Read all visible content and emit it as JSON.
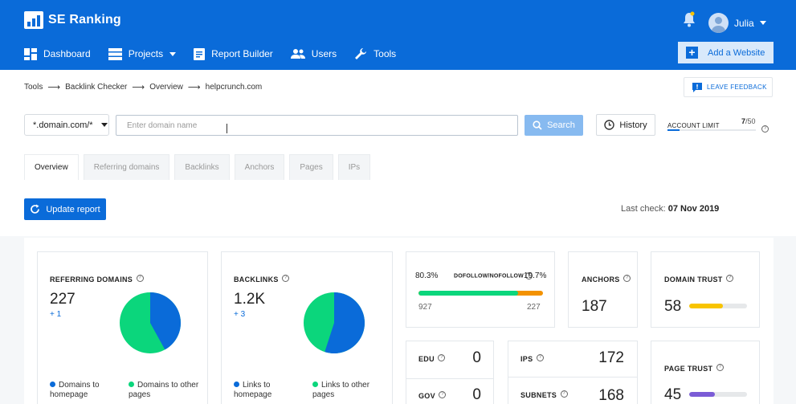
{
  "app": {
    "name": "SE Ranking"
  },
  "user": {
    "name": "Julia"
  },
  "nav": [
    {
      "id": "dashboard",
      "label": "Dashboard"
    },
    {
      "id": "projects",
      "label": "Projects"
    },
    {
      "id": "report-builder",
      "label": "Report Builder"
    },
    {
      "id": "users",
      "label": "Users"
    },
    {
      "id": "tools",
      "label": "Tools"
    }
  ],
  "add_website_label": "Add a Website",
  "breadcrumb": [
    "Tools",
    "Backlink Checker",
    "Overview",
    "helpcrunch.com"
  ],
  "leave_feedback_label": "LEAVE FEEDBACK",
  "search": {
    "mode": "*.domain.com/*",
    "placeholder": "Enter domain name",
    "button": "Search",
    "history": "History"
  },
  "account_limit": {
    "label": "ACCOUNT LIMIT",
    "used": "7",
    "total": "/50",
    "fraction": 0.14
  },
  "tabs": [
    "Overview",
    "Referring domains",
    "Backlinks",
    "Anchors",
    "Pages",
    "IPs"
  ],
  "update_report_label": "Update report",
  "last_check": {
    "label": "Last check:",
    "date": "07 Nov 2019"
  },
  "referring_domains": {
    "title": "REFERRING DOMAINS",
    "value": "227",
    "delta": "+ 1",
    "legend": [
      "Domains to homepage",
      "Domains to other pages"
    ],
    "homepage_fraction": 0.42
  },
  "backlinks": {
    "title": "BACKLINKS",
    "value": "1.2K",
    "delta": "+ 3",
    "legend": [
      "Links to homepage",
      "Links to other pages"
    ],
    "homepage_fraction": 0.55
  },
  "dofollow": {
    "title": "DOFOLLOW/NOFOLLOW",
    "dofollow_pct": "80.3%",
    "nofollow_pct": "19.7%",
    "dofollow_count": "927",
    "nofollow_count": "227",
    "fraction": 0.803
  },
  "anchors": {
    "title": "ANCHORS",
    "value": "187"
  },
  "domain_trust": {
    "title": "DOMAIN TRUST",
    "value": "58",
    "fraction": 0.58
  },
  "edu": {
    "title": "EDU",
    "value": "0"
  },
  "gov": {
    "title": "GOV",
    "value": "0"
  },
  "ips": {
    "title": "IPS",
    "value": "172"
  },
  "subnets": {
    "title": "SUBNETS",
    "value": "168"
  },
  "page_trust": {
    "title": "PAGE TRUST",
    "value": "45",
    "fraction": 0.45
  },
  "colors": {
    "brand": "#0a6bd9",
    "green": "#0bd67c",
    "orange": "#f39200",
    "yellow": "#f8c400",
    "purple": "#7b5cd6"
  }
}
